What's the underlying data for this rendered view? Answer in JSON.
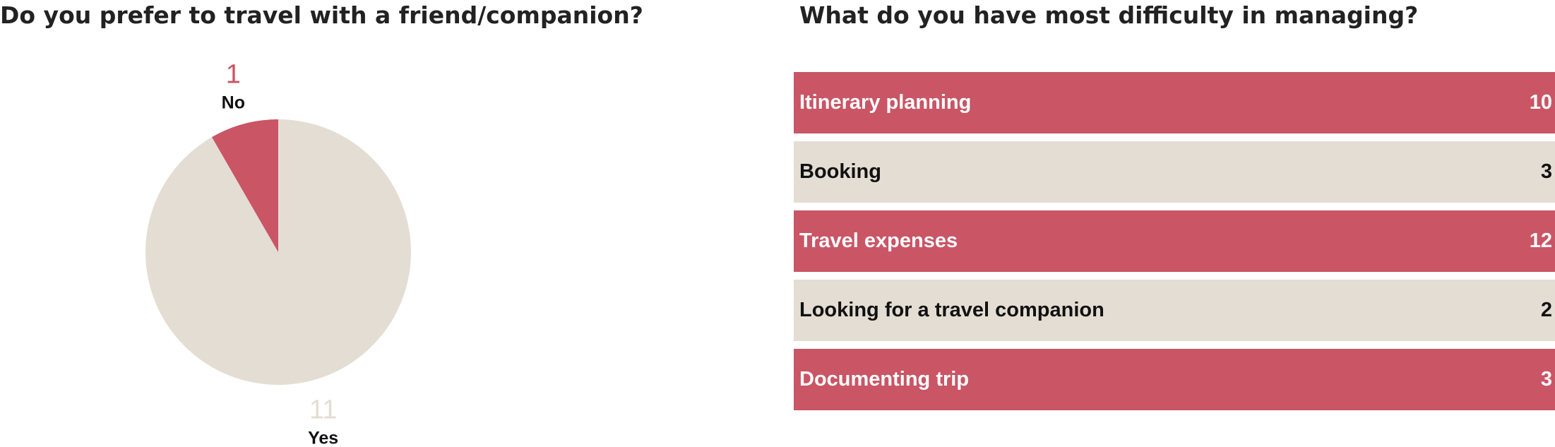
{
  "chart_data": [
    {
      "type": "pie",
      "title": "Do you prefer to travel with a friend/companion?",
      "slices": [
        {
          "label": "Yes",
          "value": 11,
          "color": "#e4ddd3",
          "label_color": "#e4ddd3"
        },
        {
          "label": "No",
          "value": 1,
          "color": "#c95565",
          "label_color": "#c95565"
        }
      ]
    },
    {
      "type": "bar",
      "orientation": "horizontal",
      "title": "What do you have most difficulty in managing?",
      "categories": [
        "Itinerary planning",
        "Booking",
        "Travel expenses",
        "Looking for a travel companion",
        "Documenting trip"
      ],
      "values": [
        10,
        3,
        12,
        2,
        3
      ],
      "colors": [
        "#c95565",
        "#e4ddd3",
        "#c95565",
        "#e4ddd3",
        "#c95565"
      ],
      "text_colors": [
        "#ffffff",
        "#111111",
        "#ffffff",
        "#111111",
        "#ffffff"
      ]
    }
  ]
}
